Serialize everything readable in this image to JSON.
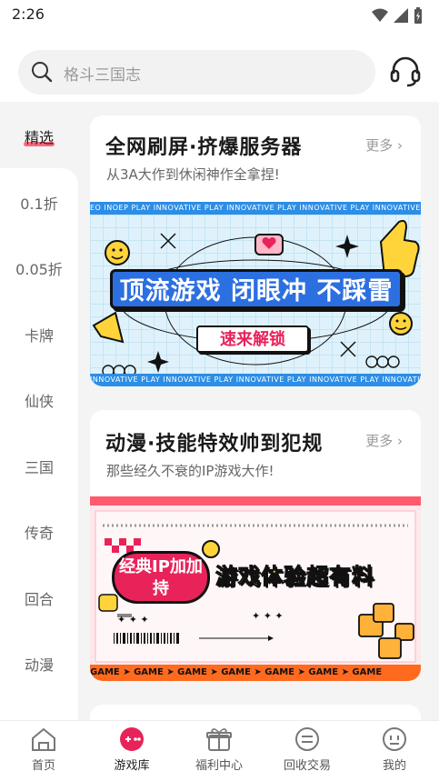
{
  "status": {
    "time": "2:26"
  },
  "search": {
    "placeholder": "格斗三国志"
  },
  "sidebar": {
    "items": [
      {
        "label": "精选",
        "active": true
      },
      {
        "label": "0.1折"
      },
      {
        "label": "0.05折"
      },
      {
        "label": "卡牌"
      },
      {
        "label": "仙侠"
      },
      {
        "label": "三国"
      },
      {
        "label": "传奇"
      },
      {
        "label": "回合"
      },
      {
        "label": "动漫"
      }
    ]
  },
  "cards": [
    {
      "title": "全网刷屏·挤爆服务器",
      "more": "更多",
      "subtitle": "从3A大作到休闲神作全拿捏!",
      "banner": {
        "strip_text": "EO INOEP PLAY   INNOVATIVE PLAY   INNOVATIVE PLAY   INNOVATIVE PLAY   INNOVATIVE PLAY",
        "bottom_strip_text": "INNOVATIVE PLAY   INNOVATIVE PLAY   INNOVATIVE PLAY   INNOVATIVE PLAY   INNOVATIVE PLAY",
        "headline": "顶流游戏 闭眼冲 不踩雷",
        "button": "速来解锁"
      }
    },
    {
      "title": "动漫·技能特效帅到犯规",
      "more": "更多",
      "subtitle": "那些经久不衰的IP游戏大作!",
      "banner": {
        "pill_text": "经典IP加加持",
        "headline": "游戏体验超有料",
        "bottom_strip_text": "GAME ➤ GAME ➤ GAME ➤ GAME ➤ GAME ➤ GAME ➤ GAME"
      }
    }
  ],
  "bottom_nav": [
    {
      "label": "首页",
      "icon": "home-icon"
    },
    {
      "label": "游戏库",
      "icon": "game-library-icon",
      "active": true
    },
    {
      "label": "福利中心",
      "icon": "gift-icon"
    },
    {
      "label": "回收交易",
      "icon": "trade-icon"
    },
    {
      "label": "我的",
      "icon": "profile-icon"
    }
  ],
  "colors": {
    "accent": "#e8235a",
    "banner_blue": "#2c8ee6",
    "banner_orange": "#ff6a1f"
  }
}
